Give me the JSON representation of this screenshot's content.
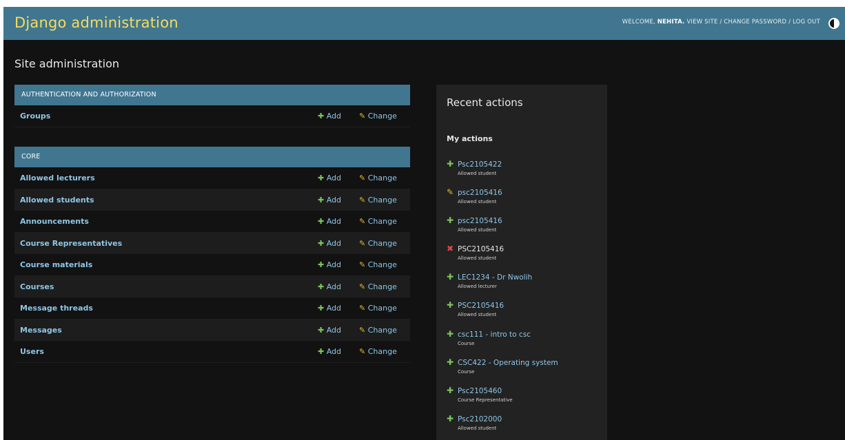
{
  "header": {
    "brand": "Django administration",
    "welcome": "WELCOME,",
    "username": "NEHITA.",
    "view_site": "VIEW SITE",
    "sep1": " / ",
    "change_password": "CHANGE PASSWORD",
    "sep2": " / ",
    "log_out": "LOG OUT"
  },
  "page_title": "Site administration",
  "modules": [
    {
      "caption": "Authentication and Authorization",
      "rows": [
        {
          "name": "Groups",
          "add": "Add",
          "change": "Change"
        }
      ]
    },
    {
      "caption": "Core",
      "rows": [
        {
          "name": "Allowed lecturers",
          "add": "Add",
          "change": "Change"
        },
        {
          "name": "Allowed students",
          "add": "Add",
          "change": "Change"
        },
        {
          "name": "Announcements",
          "add": "Add",
          "change": "Change"
        },
        {
          "name": "Course Representatives",
          "add": "Add",
          "change": "Change"
        },
        {
          "name": "Course materials",
          "add": "Add",
          "change": "Change"
        },
        {
          "name": "Courses",
          "add": "Add",
          "change": "Change"
        },
        {
          "name": "Message threads",
          "add": "Add",
          "change": "Change"
        },
        {
          "name": "Messages",
          "add": "Add",
          "change": "Change"
        },
        {
          "name": "Users",
          "add": "Add",
          "change": "Change"
        }
      ]
    }
  ],
  "recent": {
    "title": "Recent actions",
    "subtitle": "My actions",
    "actions": [
      {
        "icon": "add-icon",
        "label": "Psc2105422",
        "type": "Allowed student"
      },
      {
        "icon": "change-icon",
        "label": "psc2105416",
        "type": "Allowed student"
      },
      {
        "icon": "add-icon",
        "label": "psc2105416",
        "type": "Allowed student"
      },
      {
        "icon": "delete-icon",
        "label": "PSC2105416",
        "type": "Allowed student"
      },
      {
        "icon": "add-icon",
        "label": "LEC1234 - Dr Nwolih",
        "type": "Allowed lecturer"
      },
      {
        "icon": "add-icon",
        "label": "PSC2105416",
        "type": "Allowed student"
      },
      {
        "icon": "add-icon",
        "label": "csc111 - intro to csc",
        "type": "Course"
      },
      {
        "icon": "add-icon",
        "label": "CSC422 - Operating system",
        "type": "Course"
      },
      {
        "icon": "add-icon",
        "label": "Psc2105460",
        "type": "Course Representative"
      },
      {
        "icon": "add-icon",
        "label": "Psc2102000",
        "type": "Allowed student"
      }
    ]
  },
  "colors": {
    "header_bg": "#417690",
    "brand": "#f5dd5d",
    "link": "#8fc6e6",
    "add_green": "#7bc45a",
    "change_yellow": "#e3b930",
    "delete_red": "#e54343",
    "page_bg": "#121212"
  }
}
